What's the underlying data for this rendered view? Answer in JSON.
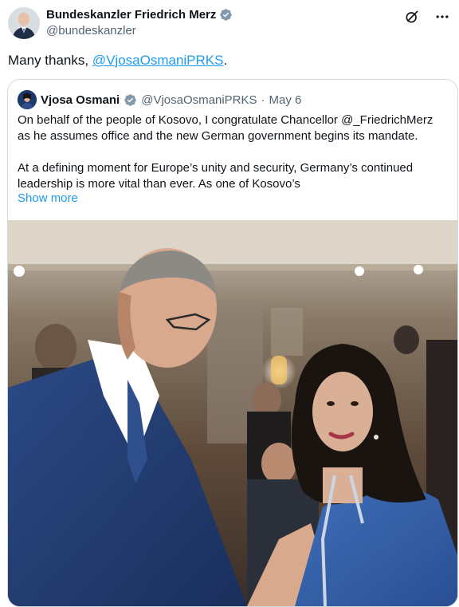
{
  "author": {
    "name": "Bundeskanzler Friedrich Merz",
    "handle": "@bundeskanzler"
  },
  "tweet": {
    "text_prefix": "Many thanks, ",
    "mention": "@VjosaOsmaniPRKS",
    "text_suffix": "."
  },
  "quote": {
    "name": "Vjosa Osmani",
    "handle": "@VjosaOsmaniPRKS",
    "separator": "·",
    "date": "May 6",
    "paragraph1": "On behalf of the people of Kosovo, I congratulate Chancellor @_FriedrichMerz as he assumes office and the new German government begins its mandate.",
    "paragraph2": "At a defining moment for Europe’s unity and security, Germany’s continued leadership is more vital than ever. As one of Kosovo’s",
    "show_more": "Show more"
  },
  "colors": {
    "link": "#1d9bf0",
    "verified": "#829aab",
    "secondary_text": "#536471"
  },
  "icons": {
    "verified": "verified-badge-icon",
    "grok": "grok-icon",
    "more": "more-dots-icon"
  }
}
